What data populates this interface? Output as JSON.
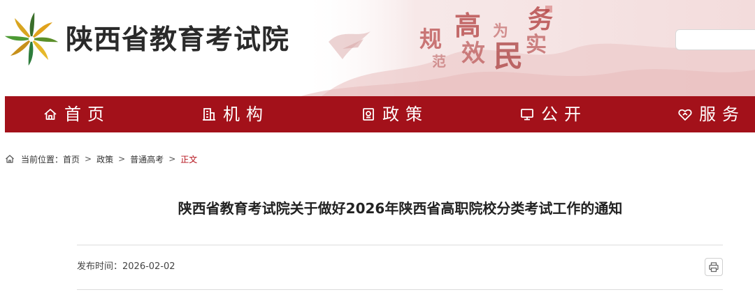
{
  "header": {
    "site_name": "陕西省教育考试院",
    "slogan": [
      "规",
      "范",
      "高",
      "效",
      "为",
      "民",
      "务",
      "实"
    ],
    "search": {
      "value": "",
      "placeholder": ""
    }
  },
  "nav": {
    "items": [
      {
        "label": "首页",
        "icon": "home-icon"
      },
      {
        "label": "机构",
        "icon": "building-icon"
      },
      {
        "label": "政策",
        "icon": "document-icon"
      },
      {
        "label": "公开",
        "icon": "monitor-icon"
      },
      {
        "label": "服务",
        "icon": "handshake-icon"
      }
    ]
  },
  "breadcrumb": {
    "prefix": "当前位置：",
    "items": [
      "首页",
      "政策",
      "普通高考"
    ],
    "separator": ">",
    "current": "正文"
  },
  "article": {
    "title": "陕西省教育考试院关于做好2026年陕西省高职院校分类考试工作的通知",
    "meta_label": "发布时间：",
    "publish_date": "2026-02-02"
  },
  "colors": {
    "nav_background": "#a3111a",
    "current_crumb": "#b5121b"
  }
}
